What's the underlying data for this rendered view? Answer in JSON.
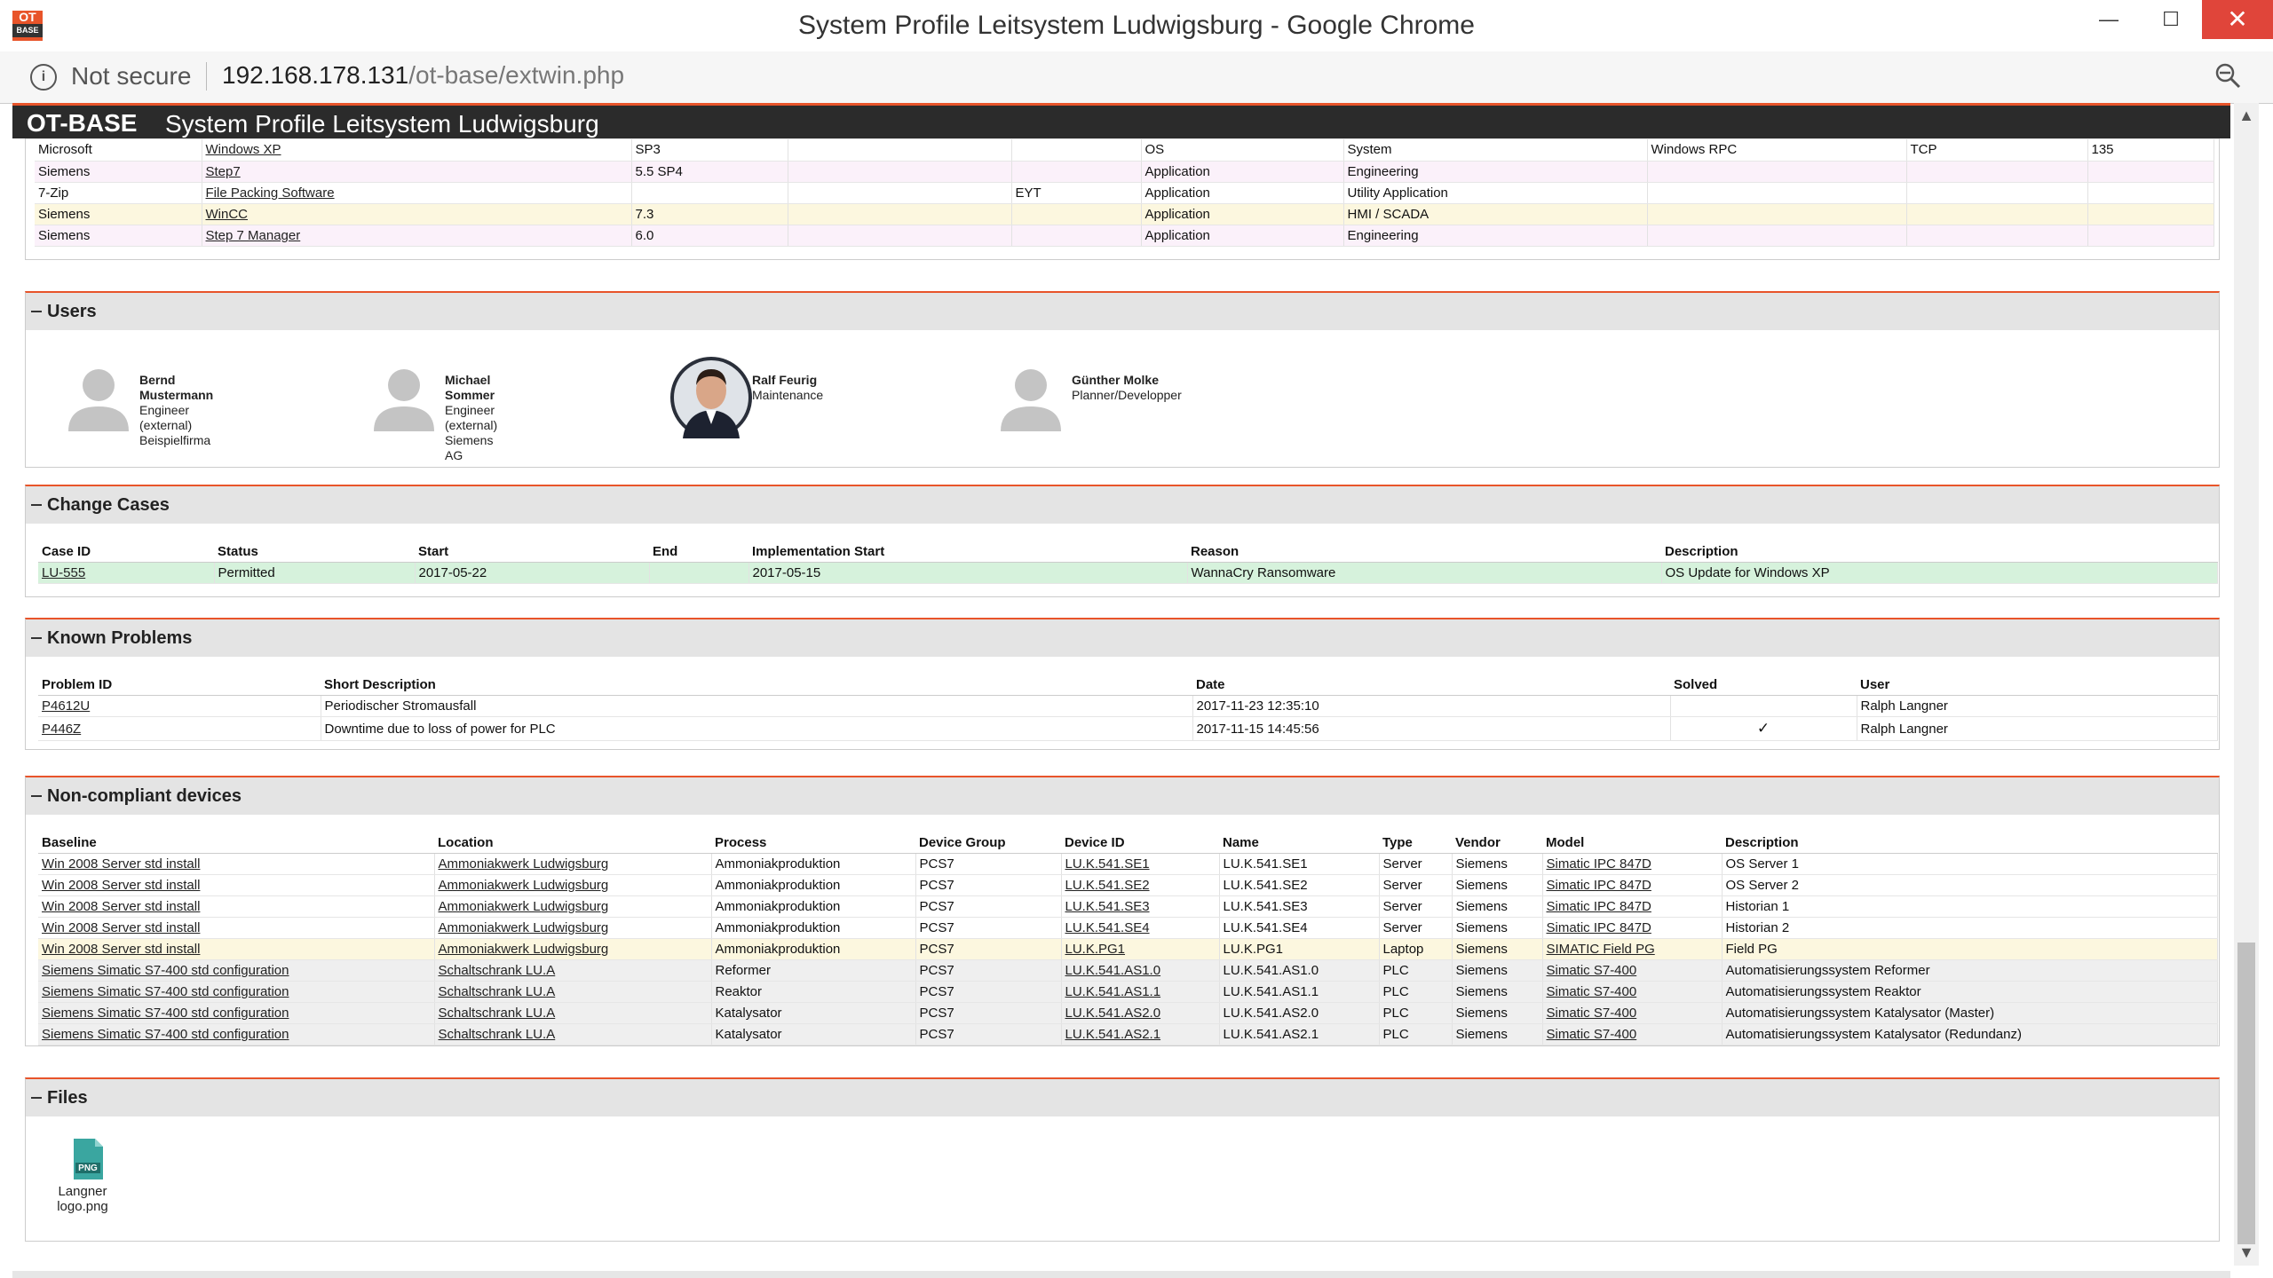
{
  "window": {
    "title": "System Profile Leitsystem Ludwigsburg - Google Chrome",
    "minimize": "—",
    "maximize": "☐",
    "close": "✕"
  },
  "app_icon": {
    "top": "OT",
    "bottom": "BASE"
  },
  "address_bar": {
    "security_label": "Not secure",
    "url_host": "192.168.178.131",
    "url_path": "/ot-base/extwin.php"
  },
  "header": {
    "logo": "OT-BASE",
    "title": "System Profile  Leitsystem Ludwigsburg"
  },
  "software": {
    "rows": [
      {
        "style": "white",
        "cells": [
          "Microsoft",
          "Windows XP",
          "SP3",
          "",
          "",
          "OS",
          "System",
          "Windows RPC",
          "TCP",
          "135"
        ],
        "link": [
          1
        ]
      },
      {
        "style": "pink",
        "cells": [
          "Siemens",
          "Step7",
          "5.5 SP4",
          "",
          "",
          "Application",
          "Engineering",
          "",
          "",
          ""
        ],
        "link": [
          1
        ]
      },
      {
        "style": "white",
        "cells": [
          "7-Zip",
          "File Packing Software",
          "",
          "",
          "EYT",
          "Application",
          "Utility Application",
          "",
          "",
          ""
        ],
        "link": [
          1
        ]
      },
      {
        "style": "yellow",
        "cells": [
          "Siemens",
          "WinCC",
          "7.3",
          "",
          "",
          "Application",
          "HMI / SCADA",
          "",
          "",
          ""
        ],
        "link": [
          1
        ]
      },
      {
        "style": "pink",
        "cells": [
          "Siemens",
          "Step 7 Manager",
          "6.0",
          "",
          "",
          "Application",
          "Engineering",
          "",
          "",
          ""
        ],
        "link": [
          1
        ]
      }
    ]
  },
  "users": {
    "title": "Users",
    "items": [
      {
        "name": "Bernd Mustermann",
        "role": "Engineer (external)",
        "org": "Beispielfirma",
        "photo": false
      },
      {
        "name": "Michael Sommer",
        "role": "Engineer (external)",
        "org": "Siemens AG",
        "photo": false
      },
      {
        "name": "Ralf Feurig",
        "role": "Maintenance",
        "org": "",
        "photo": true
      },
      {
        "name": "Günther Molke",
        "role": "Planner/Developper",
        "org": "",
        "photo": false
      }
    ]
  },
  "change_cases": {
    "title": "Change Cases",
    "columns": [
      "Case ID",
      "Status",
      "Start",
      "End",
      "Implementation Start",
      "Reason",
      "Description"
    ],
    "rows": [
      {
        "style": "green",
        "cells": [
          "LU-555",
          "Permitted",
          "2017-05-22",
          "",
          "2017-05-15",
          "WannaCry Ransomware",
          "OS Update for Windows XP"
        ],
        "link": [
          0
        ]
      }
    ]
  },
  "known_problems": {
    "title": "Known Problems",
    "columns": [
      "Problem ID",
      "Short Description",
      "Date",
      "Solved",
      "User"
    ],
    "rows": [
      {
        "style": "white",
        "cells": [
          "P4612U",
          "Periodischer Stromausfall",
          "2017-11-23 12:35:10",
          "",
          "Ralph Langner"
        ],
        "link": [
          0
        ]
      },
      {
        "style": "white",
        "cells": [
          "P446Z",
          "Downtime due to loss of power for PLC",
          "2017-11-15 14:45:56",
          "✓",
          "Ralph Langner"
        ],
        "link": [
          0
        ]
      }
    ]
  },
  "noncompliant": {
    "title": "Non-compliant devices",
    "columns": [
      "Baseline",
      "Location",
      "Process",
      "Device Group",
      "Device ID",
      "Name",
      "Type",
      "Vendor",
      "Model",
      "Description"
    ],
    "rows": [
      {
        "style": "white",
        "cells": [
          "Win 2008 Server std install",
          "Ammoniakwerk Ludwigsburg",
          "Ammoniakproduktion",
          "PCS7",
          "LU.K.541.SE1",
          "LU.K.541.SE1",
          "Server",
          "Siemens",
          "Simatic IPC 847D",
          "OS Server 1"
        ],
        "link": [
          0,
          1,
          4,
          8
        ]
      },
      {
        "style": "white",
        "cells": [
          "Win 2008 Server std install",
          "Ammoniakwerk Ludwigsburg",
          "Ammoniakproduktion",
          "PCS7",
          "LU.K.541.SE2",
          "LU.K.541.SE2",
          "Server",
          "Siemens",
          "Simatic IPC 847D",
          "OS Server 2"
        ],
        "link": [
          0,
          1,
          4,
          8
        ]
      },
      {
        "style": "white",
        "cells": [
          "Win 2008 Server std install",
          "Ammoniakwerk Ludwigsburg",
          "Ammoniakproduktion",
          "PCS7",
          "LU.K.541.SE3",
          "LU.K.541.SE3",
          "Server",
          "Siemens",
          "Simatic IPC 847D",
          "Historian 1"
        ],
        "link": [
          0,
          1,
          4,
          8
        ]
      },
      {
        "style": "white",
        "cells": [
          "Win 2008 Server std install",
          "Ammoniakwerk Ludwigsburg",
          "Ammoniakproduktion",
          "PCS7",
          "LU.K.541.SE4",
          "LU.K.541.SE4",
          "Server",
          "Siemens",
          "Simatic IPC 847D",
          "Historian 2"
        ],
        "link": [
          0,
          1,
          4,
          8
        ]
      },
      {
        "style": "yellow",
        "cells": [
          "Win 2008 Server std install",
          "Ammoniakwerk Ludwigsburg",
          "Ammoniakproduktion",
          "PCS7",
          "LU.K.PG1",
          "LU.K.PG1",
          "Laptop",
          "Siemens",
          "SIMATIC Field PG",
          "Field PG"
        ],
        "link": [
          0,
          1,
          4,
          8
        ]
      },
      {
        "style": "grey",
        "cells": [
          "Siemens Simatic S7-400 std configuration",
          "Schaltschrank LU.A",
          "Reformer",
          "PCS7",
          "LU.K.541.AS1.0",
          "LU.K.541.AS1.0",
          "PLC",
          "Siemens",
          "Simatic S7-400",
          "Automatisierungssystem Reformer"
        ],
        "link": [
          0,
          1,
          4,
          8
        ]
      },
      {
        "style": "grey",
        "cells": [
          "Siemens Simatic S7-400 std configuration",
          "Schaltschrank LU.A",
          "Reaktor",
          "PCS7",
          "LU.K.541.AS1.1",
          "LU.K.541.AS1.1",
          "PLC",
          "Siemens",
          "Simatic S7-400",
          "Automatisierungssystem Reaktor"
        ],
        "link": [
          0,
          1,
          4,
          8
        ]
      },
      {
        "style": "grey",
        "cells": [
          "Siemens Simatic S7-400 std configuration",
          "Schaltschrank LU.A",
          "Katalysator",
          "PCS7",
          "LU.K.541.AS2.0",
          "LU.K.541.AS2.0",
          "PLC",
          "Siemens",
          "Simatic S7-400",
          "Automatisierungssystem Katalysator (Master)"
        ],
        "link": [
          0,
          1,
          4,
          8
        ]
      },
      {
        "style": "grey",
        "cells": [
          "Siemens Simatic S7-400 std configuration",
          "Schaltschrank LU.A",
          "Katalysator",
          "PCS7",
          "LU.K.541.AS2.1",
          "LU.K.541.AS2.1",
          "PLC",
          "Siemens",
          "Simatic S7-400",
          "Automatisierungssystem Katalysator (Redundanz)"
        ],
        "link": [
          0,
          1,
          4,
          8
        ]
      }
    ]
  },
  "files": {
    "title": "Files",
    "items": [
      {
        "badge": "PNG",
        "name_line1": "Langner",
        "name_line2": "logo.png"
      }
    ]
  },
  "colors": {
    "accent": "#e8542a",
    "header_bg": "#2b2b2b",
    "panel_head": "#e4e4e4"
  }
}
